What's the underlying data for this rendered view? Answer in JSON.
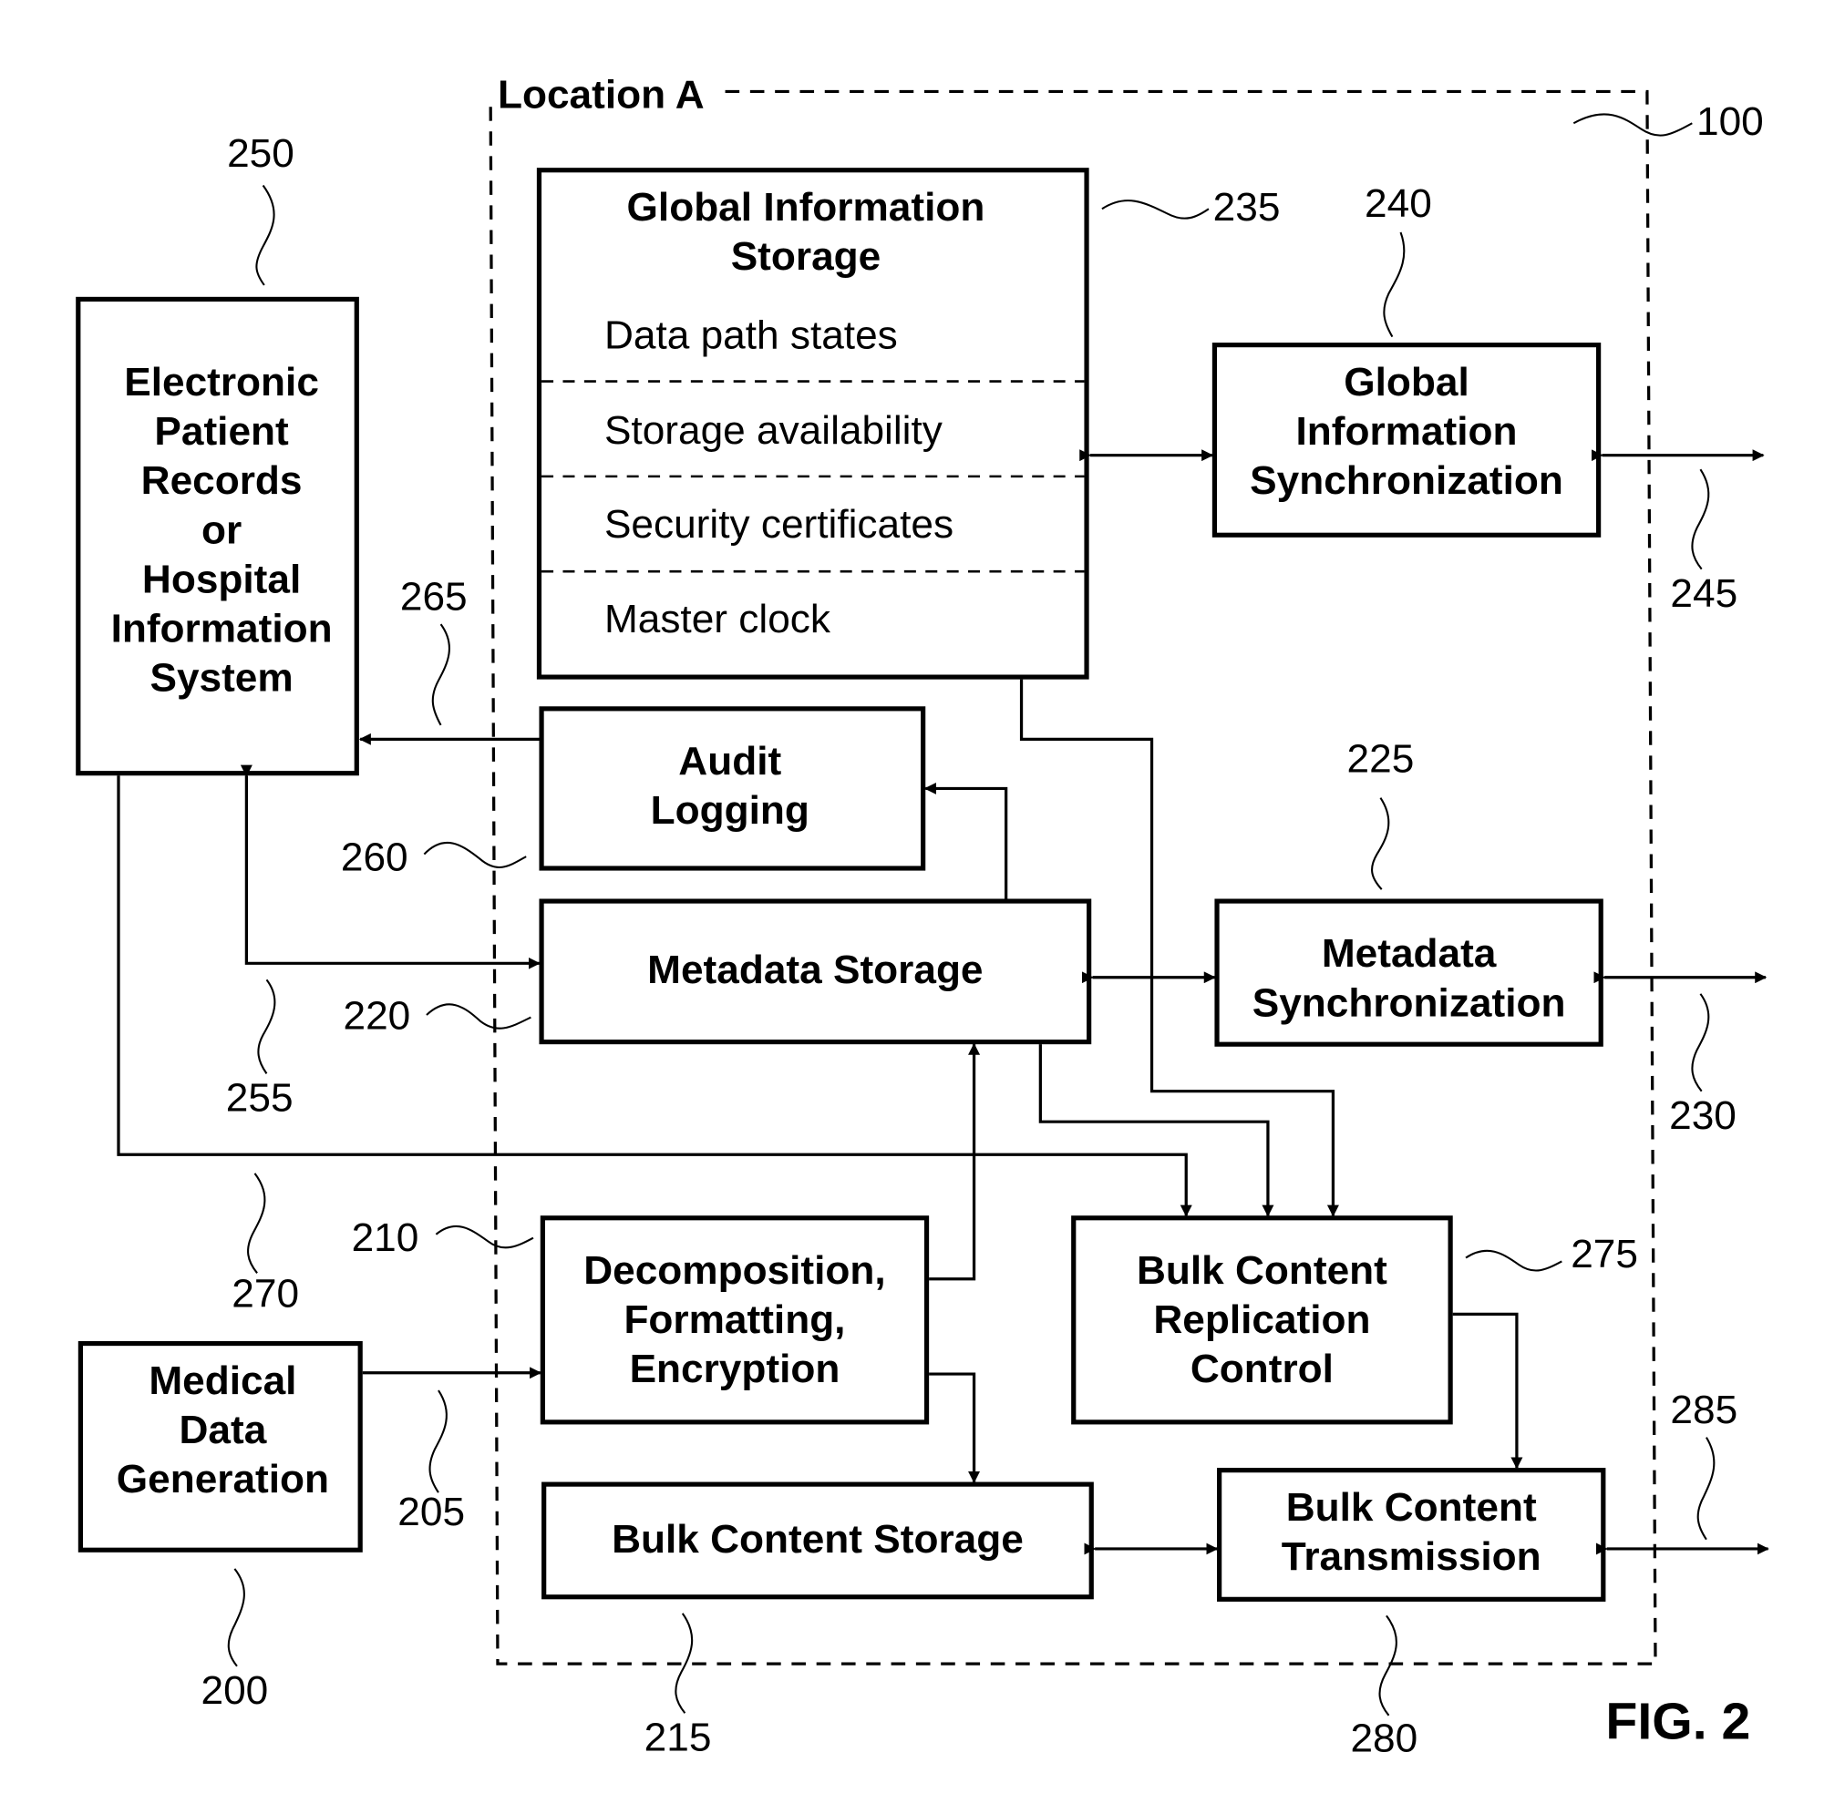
{
  "figure": {
    "label": "FIG. 2",
    "location_label": "Location A",
    "location_ref": "100"
  },
  "blocks": {
    "global_info_storage": {
      "ref": "235",
      "title": [
        "Global Information",
        "Storage"
      ],
      "items": [
        "Data path states",
        "Storage availability",
        "Security certificates",
        "Master clock"
      ]
    },
    "global_info_sync": {
      "ref": "240",
      "title": [
        "Global",
        "Information",
        "Synchronization"
      ]
    },
    "epr_his": {
      "ref": "250",
      "title": [
        "Electronic",
        "Patient",
        "Records",
        "or",
        "Hospital",
        "Information",
        "System"
      ]
    },
    "audit_logging": {
      "ref": "260",
      "title": [
        "Audit",
        "Logging"
      ]
    },
    "metadata_storage": {
      "ref": "220",
      "title": [
        "Metadata Storage"
      ]
    },
    "metadata_sync": {
      "ref": "225",
      "title": [
        "Metadata",
        "Synchronization"
      ]
    },
    "decomposition": {
      "ref": "210",
      "title": [
        "Decomposition,",
        "Formatting,",
        "Encryption"
      ]
    },
    "bulk_replication": {
      "ref": "275",
      "title": [
        "Bulk Content",
        "Replication",
        "Control"
      ]
    },
    "medical_data": {
      "ref": "200",
      "title": [
        "Medical",
        "Data",
        "Generation"
      ]
    },
    "bulk_storage": {
      "ref": "215",
      "title": [
        "Bulk Content Storage"
      ]
    },
    "bulk_transmission": {
      "ref": "280",
      "title": [
        "Bulk Content",
        "Transmission"
      ]
    }
  },
  "connections": {
    "global_external": "245",
    "metadata_external": "230",
    "bulk_external": "285",
    "audit_to_epr": "265",
    "epr_metadata": "255",
    "epr_to_replication": "270",
    "medical_to_decomposition": "205"
  }
}
